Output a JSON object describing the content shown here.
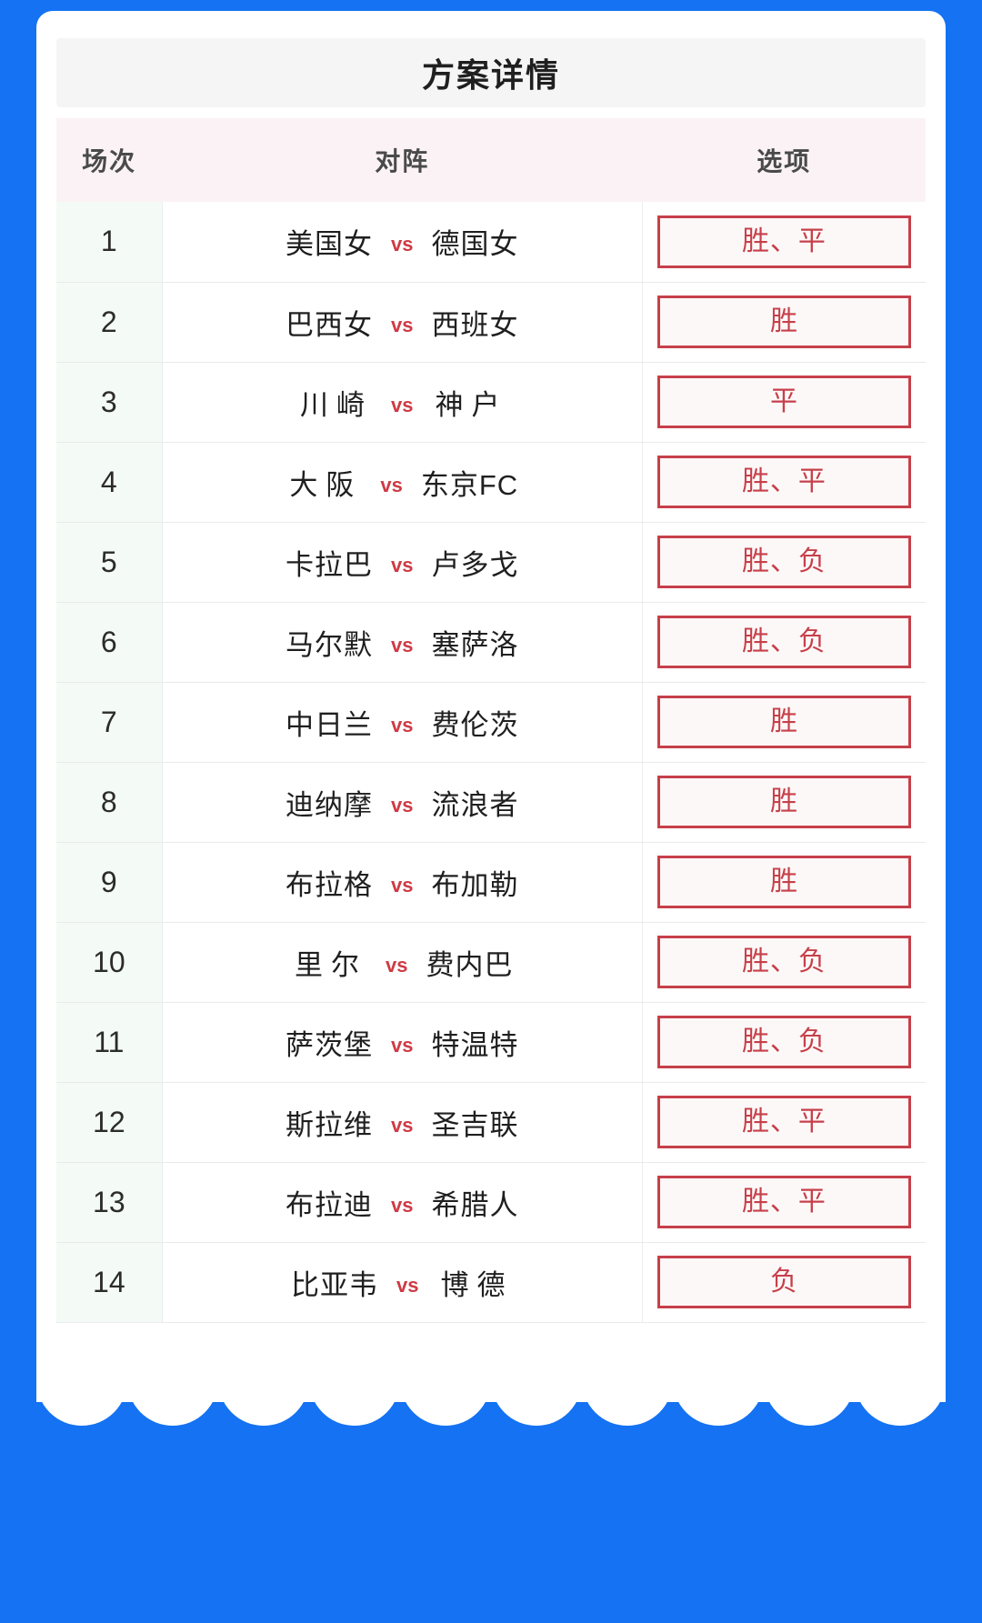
{
  "theme": {
    "background": "#1472F3",
    "card": "#ffffff",
    "title_bar_bg": "#f5f5f5",
    "header_bg": "#faf2f5",
    "no_col_bg": "#f4faf6",
    "accent_red": "#c6404a",
    "vs_red": "#cf3a44",
    "text_dark": "#1f1f1f"
  },
  "header": {
    "title": "方案详情"
  },
  "table": {
    "columns": {
      "no": "场次",
      "matchup": "对阵",
      "option": "选项"
    },
    "vs_label": "vs",
    "rows": [
      {
        "no": "1",
        "home": "美国女",
        "away": "德国女",
        "option": "胜、平"
      },
      {
        "no": "2",
        "home": "巴西女",
        "away": "西班女",
        "option": "胜"
      },
      {
        "no": "3",
        "home": "川 崎",
        "away": "神 户",
        "option": "平"
      },
      {
        "no": "4",
        "home": "大 阪",
        "away": "东京FC",
        "option": "胜、平"
      },
      {
        "no": "5",
        "home": "卡拉巴",
        "away": "卢多戈",
        "option": "胜、负"
      },
      {
        "no": "6",
        "home": "马尔默",
        "away": "塞萨洛",
        "option": "胜、负"
      },
      {
        "no": "7",
        "home": "中日兰",
        "away": "费伦茨",
        "option": "胜"
      },
      {
        "no": "8",
        "home": "迪纳摩",
        "away": "流浪者",
        "option": "胜"
      },
      {
        "no": "9",
        "home": "布拉格",
        "away": "布加勒",
        "option": "胜"
      },
      {
        "no": "10",
        "home": "里 尔",
        "away": "费内巴",
        "option": "胜、负"
      },
      {
        "no": "11",
        "home": "萨茨堡",
        "away": "特温特",
        "option": "胜、负"
      },
      {
        "no": "12",
        "home": "斯拉维",
        "away": "圣吉联",
        "option": "胜、平"
      },
      {
        "no": "13",
        "home": "布拉迪",
        "away": "希腊人",
        "option": "胜、平"
      },
      {
        "no": "14",
        "home": "比亚韦",
        "away": "博 德",
        "option": "负"
      }
    ]
  }
}
